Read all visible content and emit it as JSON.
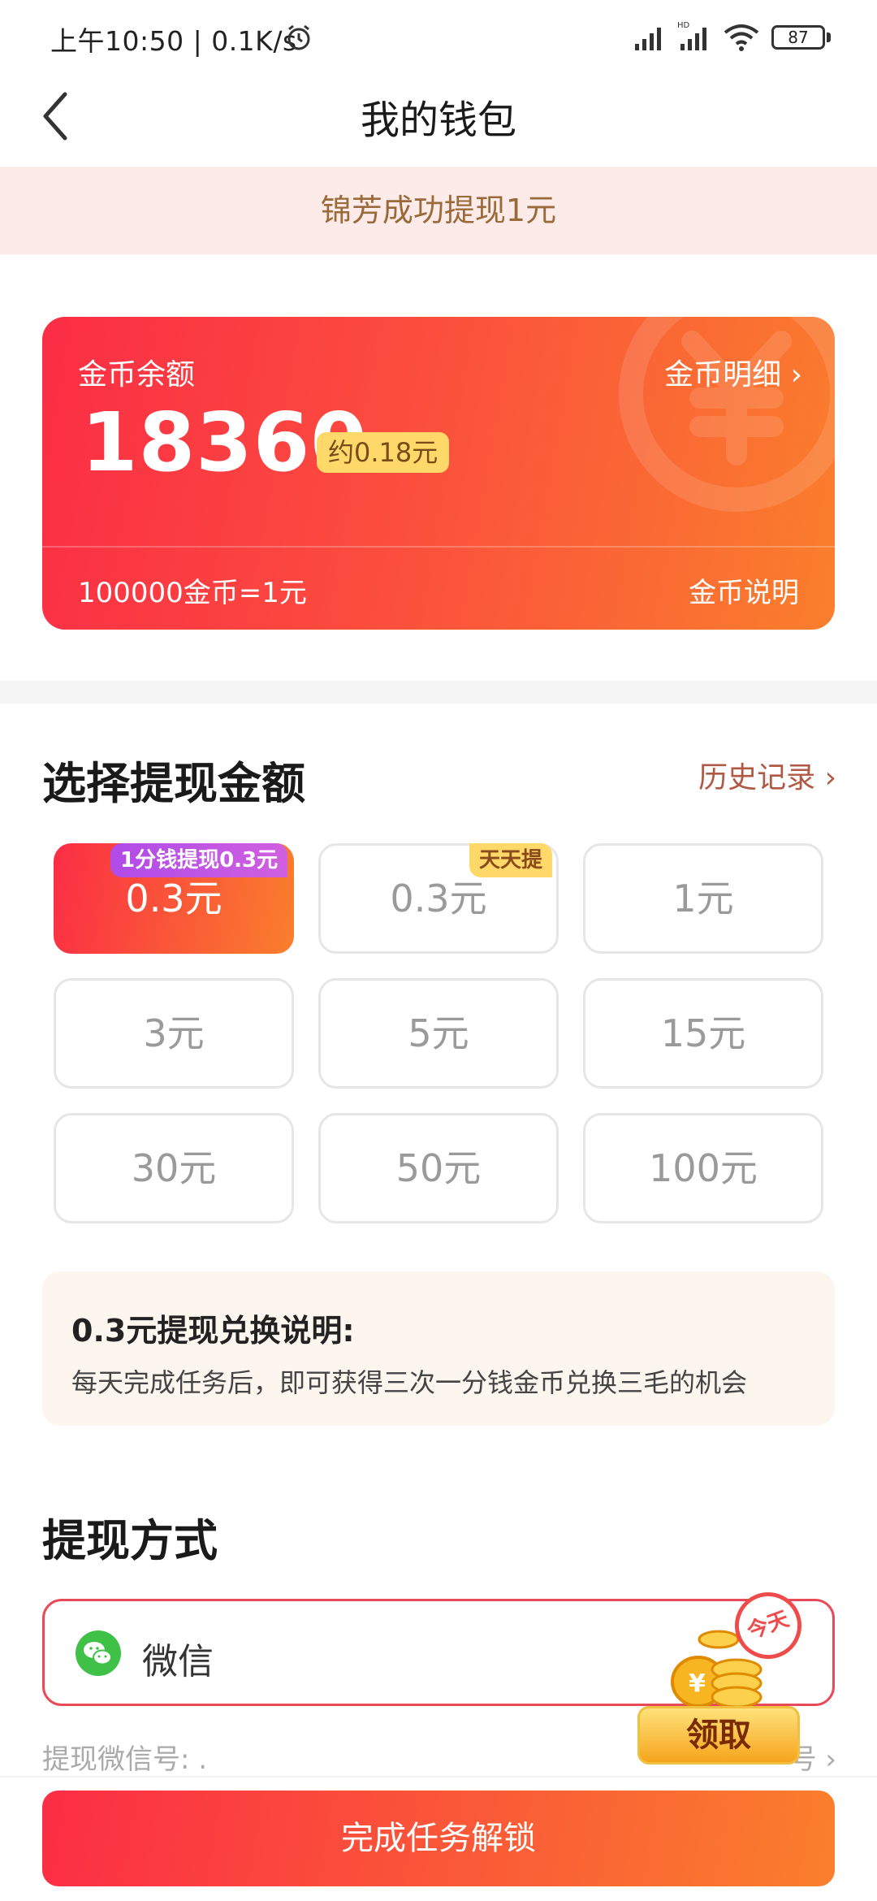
{
  "status_bar": {
    "time": "上午10:50 | 0.1K/s",
    "battery": "87"
  },
  "header": {
    "title": "我的钱包"
  },
  "notice": {
    "text": "锦芳成功提现1元"
  },
  "balance_card": {
    "label": "金币余额",
    "detail_link": "金币明细 ›",
    "amount": "18360",
    "approx": "约0.18元",
    "rate": "100000金币=1元",
    "explain_link": "金币说明"
  },
  "withdraw": {
    "title": "选择提现金额",
    "history_link": "历史记录 ›",
    "options": [
      {
        "label": "0.3元",
        "badge": "1分钱提现0.3元",
        "selected": true
      },
      {
        "label": "0.3元",
        "badge": "天天提",
        "selected": false
      },
      {
        "label": "1元",
        "badge": "",
        "selected": false
      },
      {
        "label": "3元",
        "badge": "",
        "selected": false
      },
      {
        "label": "5元",
        "badge": "",
        "selected": false
      },
      {
        "label": "15元",
        "badge": "",
        "selected": false
      },
      {
        "label": "30元",
        "badge": "",
        "selected": false
      },
      {
        "label": "50元",
        "badge": "",
        "selected": false
      },
      {
        "label": "100元",
        "badge": "",
        "selected": false
      }
    ]
  },
  "explanation": {
    "title": "0.3元提现兑换说明:",
    "body": "每天完成任务后，即可获得三次一分钱金币兑换三毛的机会"
  },
  "method": {
    "title": "提现方式",
    "selected": "微信",
    "wechat_label": "提现微信号: .",
    "bind_link": "号 ›"
  },
  "promo": {
    "button": "领取",
    "today": "今天"
  },
  "bottom": {
    "button": "完成任务解锁"
  },
  "colors": {
    "accent_start": "#fb2d45",
    "accent_end": "#fa7f2c"
  }
}
